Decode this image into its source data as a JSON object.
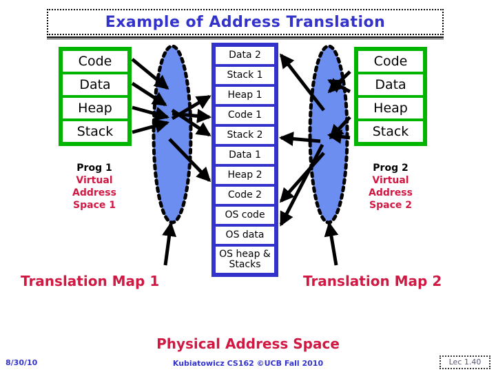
{
  "slide": {
    "title": "Example of Address Translation",
    "title_color": "#3333cc"
  },
  "left_space": {
    "segments": [
      "Code",
      "Data",
      "Heap",
      "Stack"
    ],
    "prog_label": "Prog 1",
    "vas_line1": "Virtual",
    "vas_line2": "Address",
    "vas_line3": "Space 1",
    "box_color": "#00b400"
  },
  "right_space": {
    "segments": [
      "Code",
      "Data",
      "Heap",
      "Stack"
    ],
    "prog_label": "Prog 2",
    "vas_line1": "Virtual",
    "vas_line2": "Address",
    "vas_line3": "Space 2",
    "box_color": "#00b400"
  },
  "physical_space": {
    "rows": [
      "Data 2",
      "Stack 1",
      "Heap 1",
      "Code 1",
      "Stack 2",
      "Data 1",
      "Heap 2",
      "Code 2",
      "OS code",
      "OS data",
      "OS heap & Stacks"
    ],
    "caption": "Physical Address Space",
    "box_color": "#3333cc",
    "caption_color": "#d01843"
  },
  "translation_maps": {
    "left_label": "Translation Map 1",
    "right_label": "Translation Map 2",
    "ellipse_fill": "#6b8ef0",
    "ellipse_border": "#000000",
    "label_color": "#d01843"
  },
  "footer": {
    "date": "8/30/10",
    "center": "Kubiatowicz CS162 ©UCB Fall 2010",
    "lecture": "Lec 1.40",
    "color": "#3333cc"
  }
}
